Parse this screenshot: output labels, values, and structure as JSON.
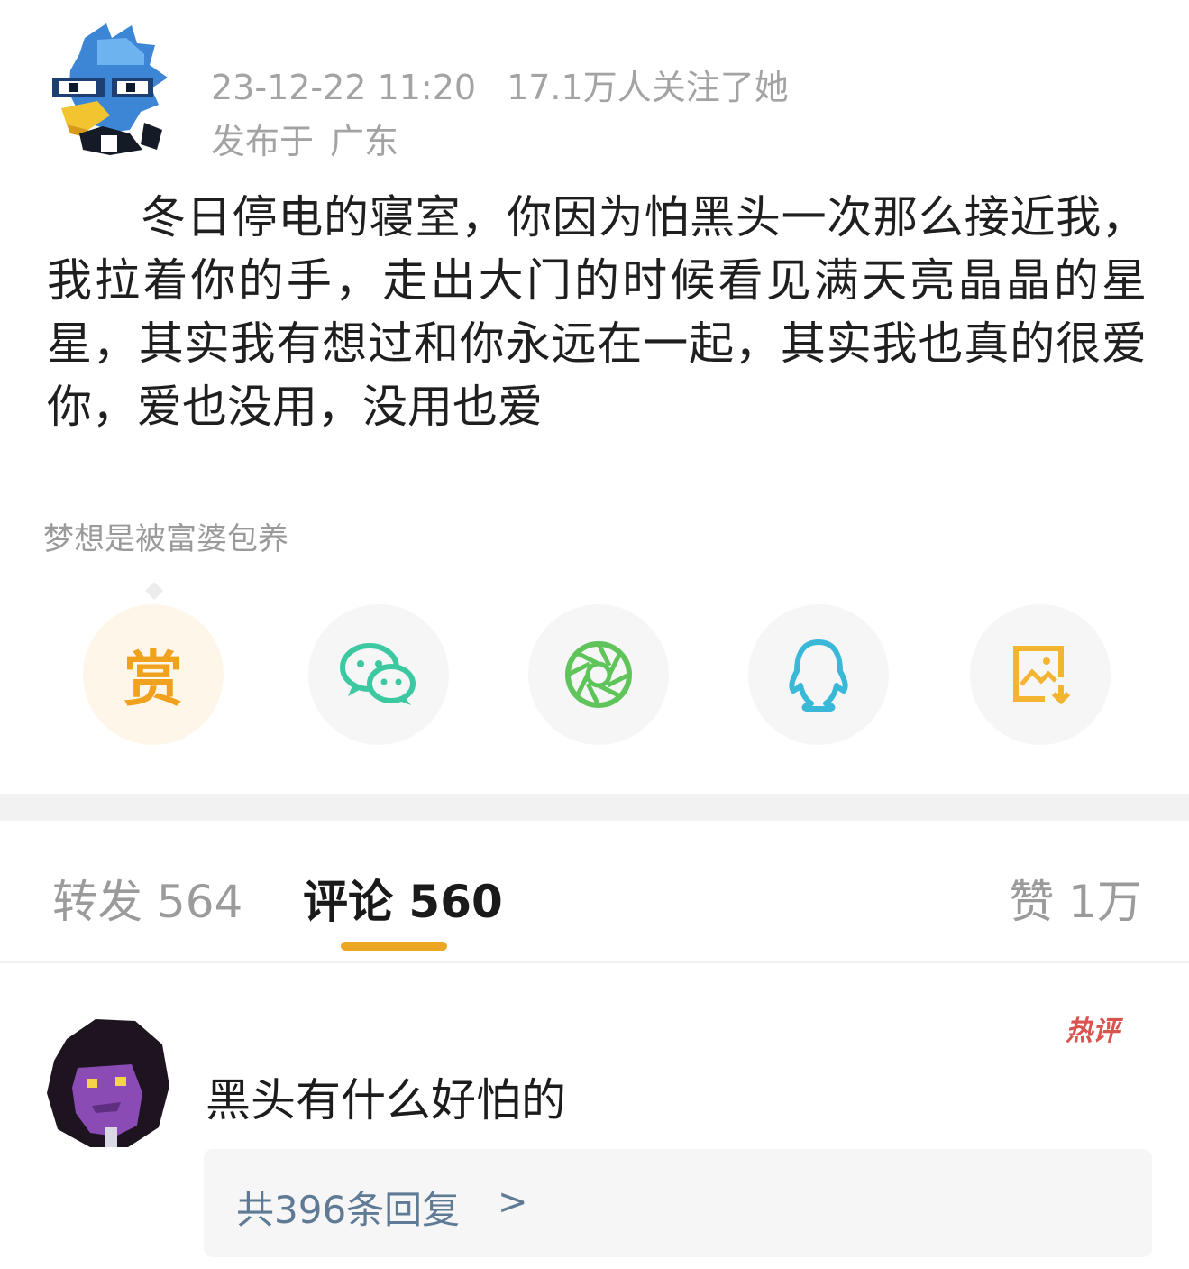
{
  "post": {
    "timestamp": "23-12-22 11:20",
    "followers": "17.1万人关注了她",
    "published_prefix": "发布于",
    "location": "广东",
    "content": "冬日停电的寝室，你因为怕黑头一次那么接近我，我拉着你的手，走出大门的时候看见满天亮晶晶的星星，其实我有想过和你永远在一起，其实我也真的很爱你，爱也没用，没用也爱",
    "signature": "梦想是被富婆包养"
  },
  "share": {
    "reward_label": "赏",
    "items": [
      {
        "icon": "reward-icon",
        "color": "#f0a21e"
      },
      {
        "icon": "wechat-icon",
        "color": "#3cc8a0"
      },
      {
        "icon": "moments-icon",
        "color": "#5fc45a"
      },
      {
        "icon": "qq-icon",
        "color": "#3ab8d8"
      },
      {
        "icon": "save-image-icon",
        "color": "#f2b431"
      }
    ]
  },
  "tabs": {
    "repost": "转发 564",
    "comments": "评论 560",
    "likes": "赞 1万",
    "active_color": "#eba624"
  },
  "comment": {
    "badge": "热评",
    "text": "黑头有什么好怕的",
    "replies_label": "共396条回复",
    "replies_arrow": ">"
  }
}
